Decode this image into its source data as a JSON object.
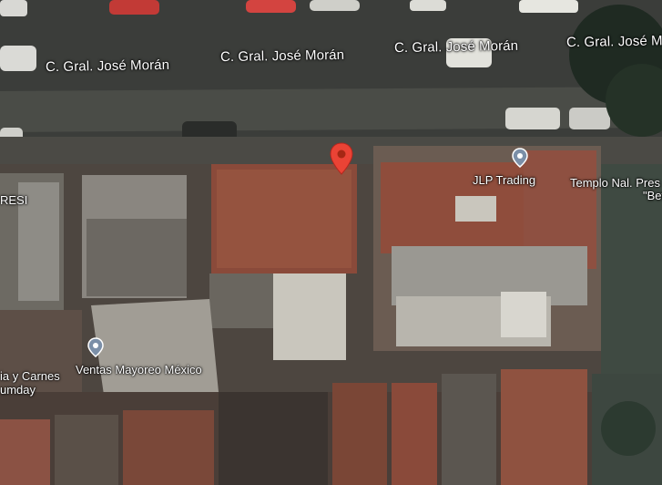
{
  "map": {
    "view": "satellite",
    "streets": [
      {
        "name": "C. Gral. José Morán"
      },
      {
        "name": "C. Gral. José Morán"
      },
      {
        "name": "C. Gral. José Morán"
      },
      {
        "name": "C. Gral. José Morán"
      }
    ],
    "places": [
      {
        "name": "JLP Trading",
        "icon": "place-pin-icon"
      },
      {
        "name": "Templo Nal. Pres",
        "sub": "\"Bet"
      },
      {
        "name": "Ventas Mayoreo México",
        "icon": "place-pin-icon"
      },
      {
        "name": "ia y Carnes",
        "sub": "umday"
      },
      {
        "name": "RESI"
      }
    ],
    "selected_marker": {
      "icon": "red-location-pin-icon",
      "color": "#ea4335"
    }
  }
}
